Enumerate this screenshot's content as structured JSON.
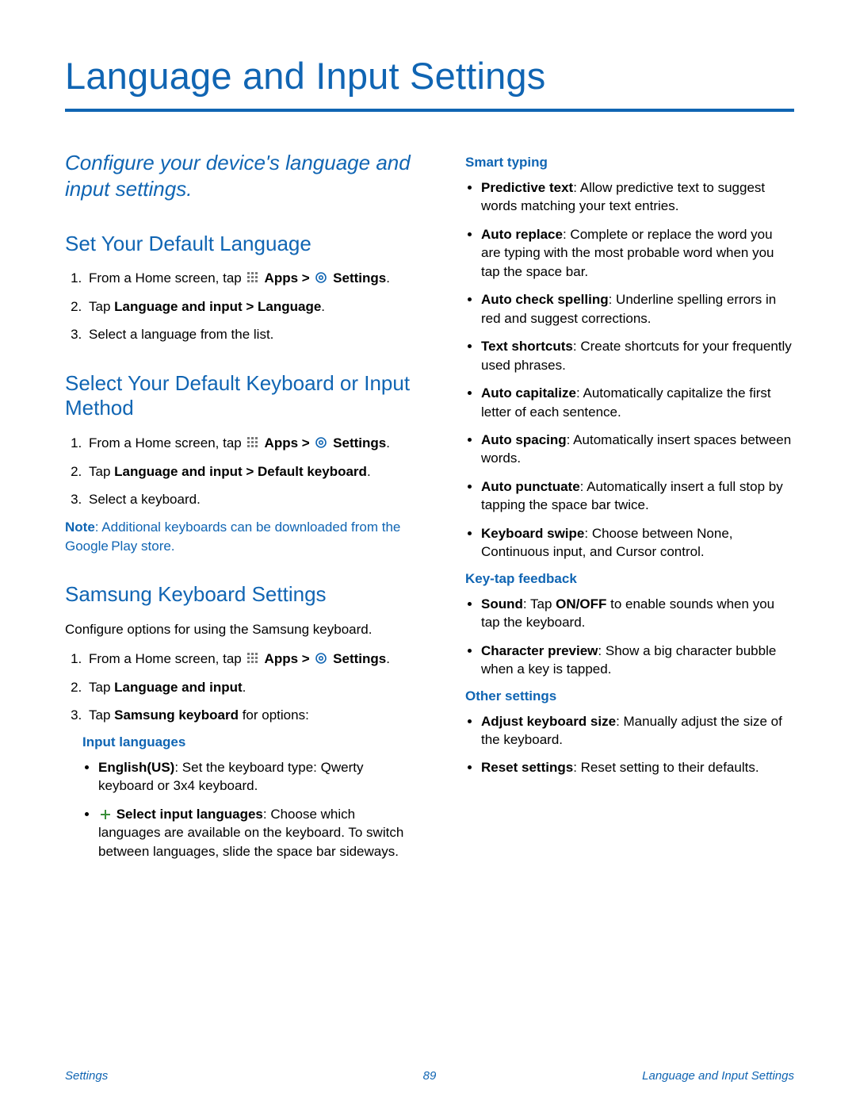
{
  "title": "Language and Input Settings",
  "intro": "Configure your device's language and input settings.",
  "section1": {
    "heading": "Set Your Default Language",
    "step1_a": "From a Home screen, tap ",
    "step1_b": " Apps > ",
    "step1_c": " Settings",
    "step1_d": ".",
    "step2_a": "Tap ",
    "step2_b": "Language and input > Language",
    "step2_c": ".",
    "step3": "Select a language from the list."
  },
  "section2": {
    "heading": "Select Your Default Keyboard or Input Method",
    "step1_a": "From a Home screen, tap ",
    "step1_b": " Apps > ",
    "step1_c": " Settings",
    "step1_d": ".",
    "step2_a": "Tap ",
    "step2_b": "Language and input > Default keyboard",
    "step2_c": ".",
    "step3": "Select a keyboard.",
    "note_lead": "Note",
    "note_body": ": Additional keyboards can be downloaded from the Google Play store."
  },
  "section3": {
    "heading": "Samsung Keyboard Settings",
    "intro_para": "Configure options for using the Samsung keyboard.",
    "step1_a": "From a Home screen, tap ",
    "step1_b": " Apps > ",
    "step1_c": " Settings",
    "step1_d": ".",
    "step2_a": "Tap ",
    "step2_b": "Language and input",
    "step2_c": ".",
    "step3_a": "Tap ",
    "step3_b": "Samsung keyboard",
    "step3_c": " for options:",
    "sub_input_lang": "Input languages",
    "il_b1_a": "English(US)",
    "il_b1_b": ": Set the keyboard type: Qwerty keyboard or 3x4 keyboard.",
    "il_b2_a": " Select input languages",
    "il_b2_b": ": Choose which languages are available on the keyboard. To switch between languages, slide the space bar sideways."
  },
  "col2": {
    "sub_smart": "Smart typing",
    "st_b1_a": "Predictive text",
    "st_b1_b": ": Allow predictive text to suggest words matching your text entries.",
    "st_b2_a": "Auto replace",
    "st_b2_b": ": Complete or replace the word you are typing with the most probable word when you tap the space bar.",
    "st_b3_a": "Auto check spelling",
    "st_b3_b": ": Underline spelling errors in red and suggest corrections.",
    "st_b4_a": "Text shortcuts",
    "st_b4_b": ": Create shortcuts for your frequently used phrases.",
    "st_b5_a": "Auto capitalize",
    "st_b5_b": ": Automatically capitalize the first letter of each sentence.",
    "st_b6_a": "Auto spacing",
    "st_b6_b": ": Automatically insert spaces between words.",
    "st_b7_a": "Auto punctuate",
    "st_b7_b": ": Automatically insert a full stop by tapping the space bar twice.",
    "st_b8_a": "Keyboard swipe",
    "st_b8_b": ": Choose between None, Continuous input, and Cursor control.",
    "sub_keytap": "Key-tap feedback",
    "kt_b1_a": "Sound",
    "kt_b1_b": ": Tap ",
    "kt_b1_c": "ON/OFF",
    "kt_b1_d": " to enable sounds when you tap the keyboard.",
    "kt_b2_a": "Character preview",
    "kt_b2_b": ": Show a big character bubble when a key is tapped.",
    "sub_other": "Other settings",
    "ot_b1_a": "Adjust keyboard size",
    "ot_b1_b": ": Manually adjust the size of the keyboard.",
    "ot_b2_a": "Reset settings",
    "ot_b2_b": ": Reset setting to their defaults."
  },
  "footer": {
    "left": "Settings",
    "center": "89",
    "right": "Language and Input Settings"
  }
}
